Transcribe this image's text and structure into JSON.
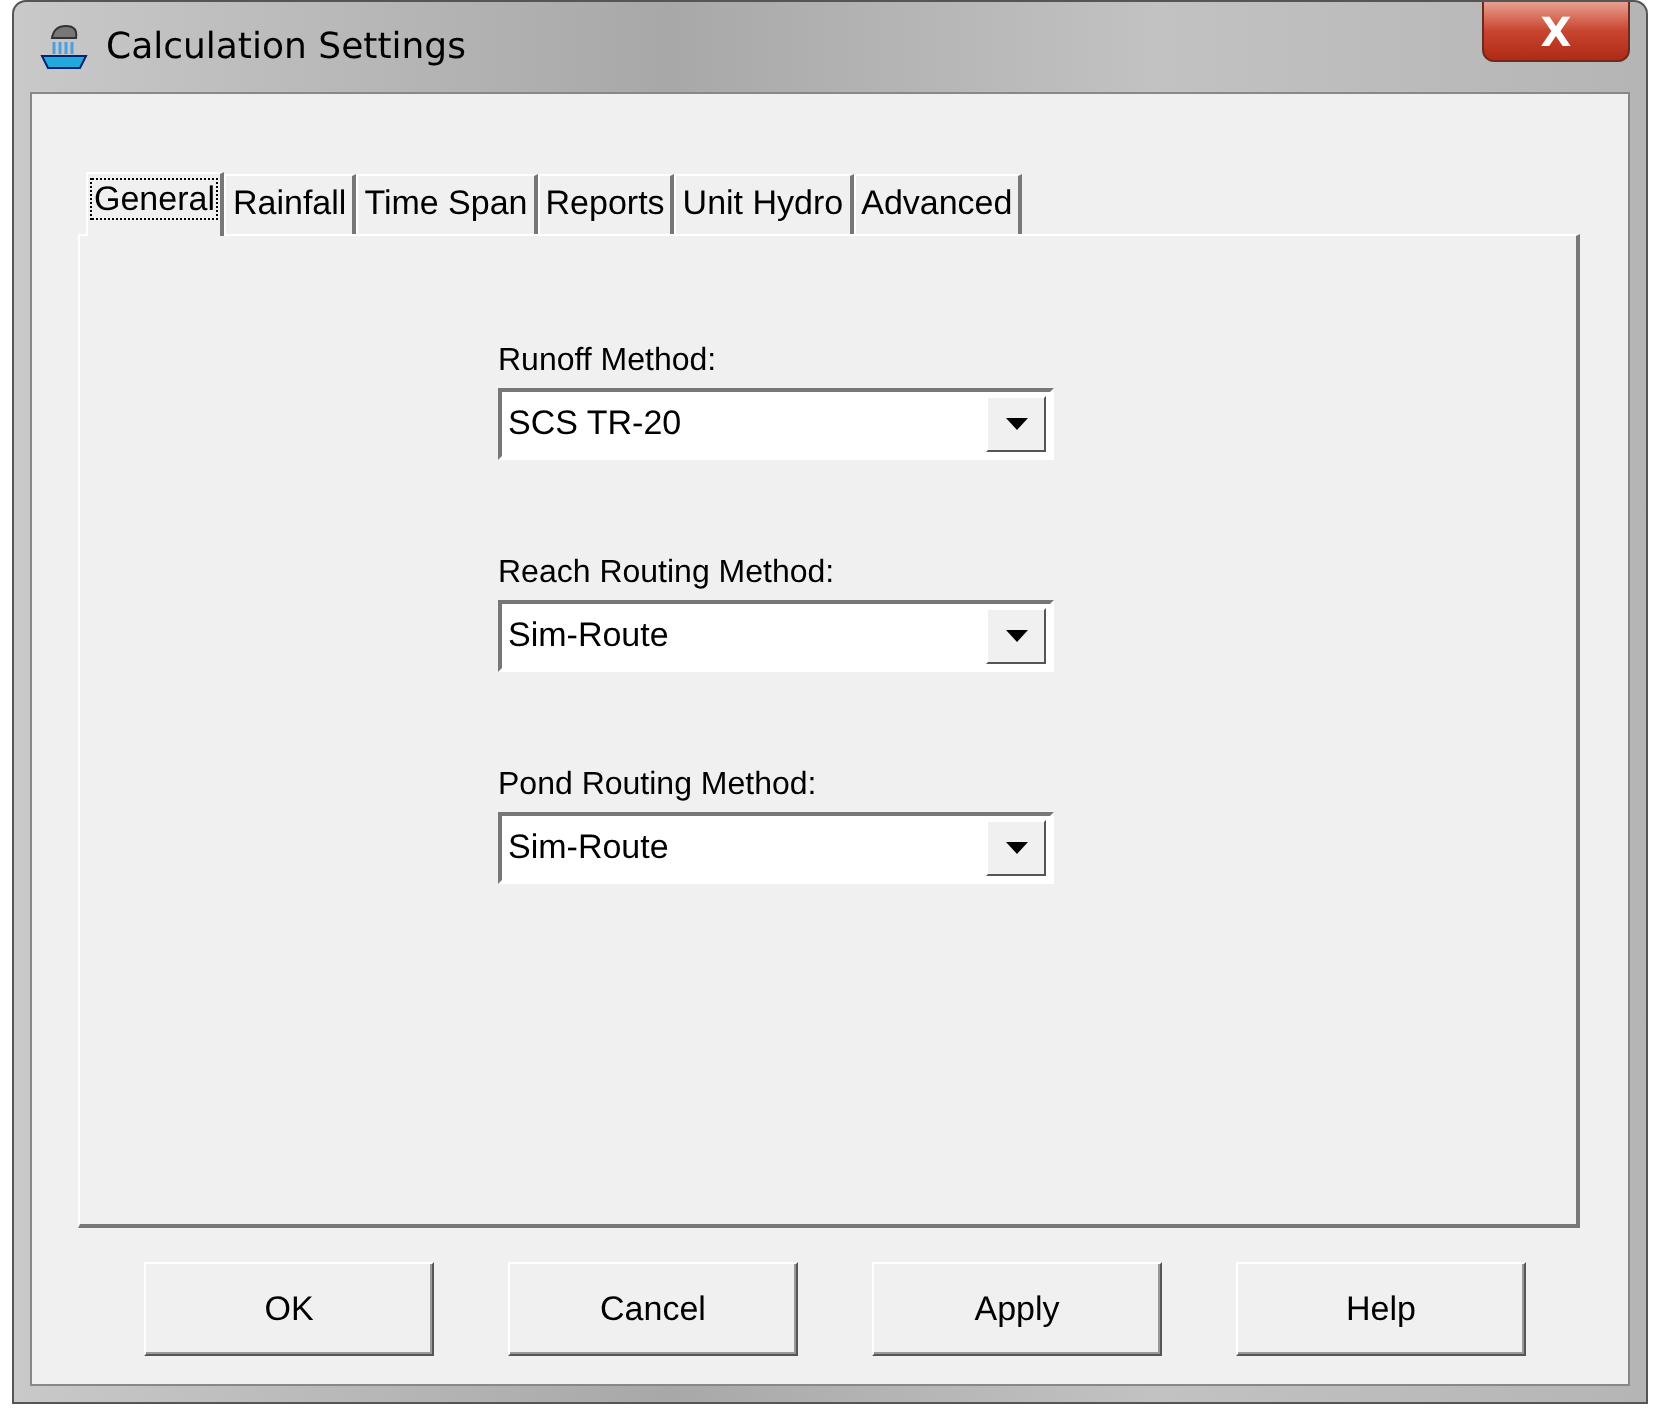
{
  "window": {
    "title": "Calculation Settings",
    "close": "X"
  },
  "tabs": [
    {
      "label": "General",
      "selected": true
    },
    {
      "label": "Rainfall",
      "selected": false
    },
    {
      "label": "Time Span",
      "selected": false
    },
    {
      "label": "Reports",
      "selected": false
    },
    {
      "label": "Unit Hydro",
      "selected": false
    },
    {
      "label": "Advanced",
      "selected": false
    }
  ],
  "fields": [
    {
      "label": "Runoff Method:",
      "value": "SCS TR-20"
    },
    {
      "label": "Reach Routing Method:",
      "value": "Sim-Route"
    },
    {
      "label": "Pond Routing Method:",
      "value": "Sim-Route"
    }
  ],
  "buttons": [
    "OK",
    "Cancel",
    "Apply",
    "Help"
  ]
}
